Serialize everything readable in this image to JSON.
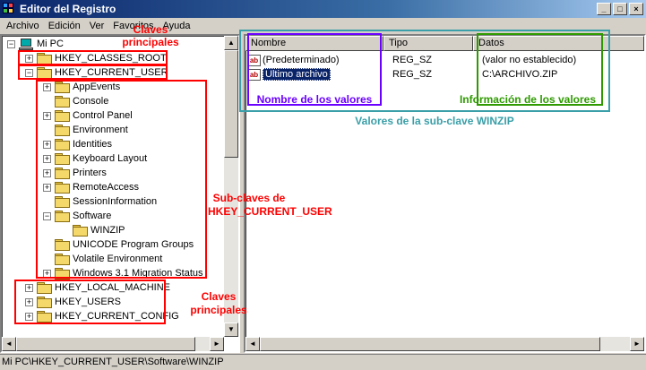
{
  "window": {
    "title": "Editor del Registro",
    "buttons": [
      "_",
      "□",
      "×"
    ]
  },
  "menu": [
    "Archivo",
    "Edición",
    "Ver",
    "Favoritos",
    "Ayuda"
  ],
  "tree": {
    "root": "Mi PC",
    "top_keys": [
      "HKEY_CLASSES_ROOT",
      "HKEY_CURRENT_USER"
    ],
    "subkeys": [
      "AppEvents",
      "Console",
      "Control Panel",
      "Environment",
      "Identities",
      "Keyboard Layout",
      "Printers",
      "RemoteAccess",
      "SessionInformation",
      "Software",
      "WINZIP",
      "UNICODE Program Groups",
      "Volatile Environment",
      "Windows 3.1 Migration Status"
    ],
    "bottom_keys": [
      "HKEY_LOCAL_MACHINE",
      "HKEY_USERS",
      "HKEY_CURRENT_CONFIG"
    ]
  },
  "list": {
    "columns": [
      "Nombre",
      "Tipo",
      "Datos"
    ],
    "rows": [
      {
        "name": "(Predeterminado)",
        "type": "REG_SZ",
        "data": "(valor no establecido)"
      },
      {
        "name": "Ultimo archivo",
        "type": "REG_SZ",
        "data": "C:\\ARCHIVO.ZIP"
      }
    ]
  },
  "status": "Mi PC\\HKEY_CURRENT_USER\\Software\\WINZIP",
  "annotations": {
    "claves_principales_top": "Claves principales",
    "claves_principales_bottom": "Claves principales",
    "subclaves": "Sub-claves de HKEY_CURRENT_USER",
    "nombre_valores": "Nombre de los valores",
    "info_valores": "Información de los valores",
    "valores_subclave": "Valores de la sub-clave WINZIP"
  },
  "colors": {
    "red": "#ff0000",
    "purple": "#6a00ff",
    "green": "#2e9a00",
    "teal": "#3a9fa8"
  }
}
